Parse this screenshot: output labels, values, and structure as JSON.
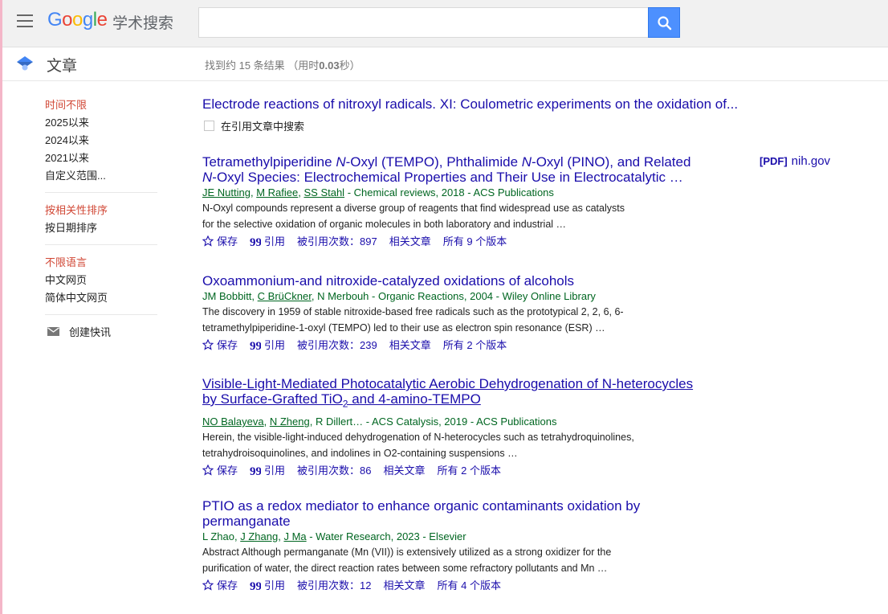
{
  "header": {
    "logo_text": "Google",
    "logo_sub": "学术搜索",
    "search_value": "",
    "search_placeholder": ""
  },
  "subheader": {
    "section_label": "文章",
    "result_count_prefix": "找到约 15 条结果 （用时",
    "result_time": "0.03",
    "result_count_suffix": "秒）"
  },
  "sidebar": {
    "time_filters": [
      "时间不限",
      "2025以来",
      "2024以来",
      "2021以来",
      "自定义范围..."
    ],
    "sort_options": [
      "按相关性排序",
      "按日期排序"
    ],
    "language_options": [
      "不限语言",
      "中文网页",
      "简体中文网页"
    ],
    "create_alert": "创建快讯"
  },
  "results": {
    "first_title": "Electrode reactions of nitroxyl radicals. XI: Coulometric experiments on the oxidation of...",
    "search_within_citing": "在引用文章中搜索",
    "items": [
      {
        "authors": [
          "JE Nutting",
          "M Rafiee",
          "SS Stahl"
        ],
        "source": " - Chemical reviews, 2018 - ACS Publications",
        "snippet": "N-Oxyl compounds represent a diverse group of reagents that find widespread use as catalysts for the selective oxidation of organic molecules in both laboratory and industrial …",
        "save": "保存",
        "cite": "引用",
        "cited_by": "被引用次数：897",
        "related": "相关文章",
        "versions": "所有 9 个版本",
        "pdf_tag": "[PDF]",
        "pdf_source": "nih.gov"
      },
      {
        "title": "Oxoammonium-and nitroxide-catalyzed oxidations of alcohols",
        "authors": [
          "JM Bobbitt",
          "C BrüCkner",
          "N Merbouh"
        ],
        "source": " - Organic Reactions, 2004 - Wiley Online Library",
        "snippet": "The discovery in 1959 of stable nitroxide-based free radicals such as the prototypical 2, 2, 6, 6-tetramethylpiperidine-1-oxyl (TEMPO) led to their use as electron spin resonance (ESR) …",
        "save": "保存",
        "cite": "引用",
        "cited_by": "被引用次数：239",
        "related": "相关文章",
        "versions": "所有 2 个版本"
      },
      {
        "authors": [
          "NO Balayeva",
          "N Zheng",
          "R Dillert"
        ],
        "source": "… - ACS Catalysis, 2019 - ACS Publications",
        "snippet": "Herein, the visible-light-induced dehydrogenation of N-heterocycles such as tetrahydroquinolines, tetrahydroisoquinolines, and indolines in O2-containing suspensions …",
        "save": "保存",
        "cite": "引用",
        "cited_by": "被引用次数：86",
        "related": "相关文章",
        "versions": "所有 2 个版本"
      },
      {
        "title": "PTIO as a redox mediator to enhance organic contaminants oxidation by permanganate",
        "authors": [
          "L Zhao",
          "J Zhang",
          "J Ma"
        ],
        "source": " - Water Research, 2023 - Elsevier",
        "snippet": "Abstract Although permanganate (Mn (VII)) is extensively utilized as a strong oxidizer for the purification of water, the direct reaction rates between some refractory pollutants and Mn …",
        "save": "保存",
        "cite": "引用",
        "cited_by": "被引用次数：12",
        "related": "相关文章",
        "versions": "所有 4 个版本"
      }
    ],
    "title_parts": {
      "r1_a": "Tetramethylpiperidine ",
      "r1_b": "N",
      "r1_c": "-Oxyl (TEMPO), Phthalimide ",
      "r1_d": "N",
      "r1_e": "-Oxyl (PINO), and Related ",
      "r1_f": "N",
      "r1_g": "-Oxyl Species: Electrochemical Properties and Their Use in Electrocatalytic …",
      "r3_a": "Visible-Light-Mediated Photocatalytic Aerobic Dehydrogenation of N-heterocycles by Surface-Grafted TiO",
      "r3_sub": "2",
      "r3_b": " and 4-amino-TEMPO"
    }
  },
  "colors": {
    "link": "#1a0dab",
    "author_green": "#006621",
    "active_red": "#d14836",
    "search_blue": "#4d90fe",
    "left_strip_pink": "#f4b6c8"
  }
}
